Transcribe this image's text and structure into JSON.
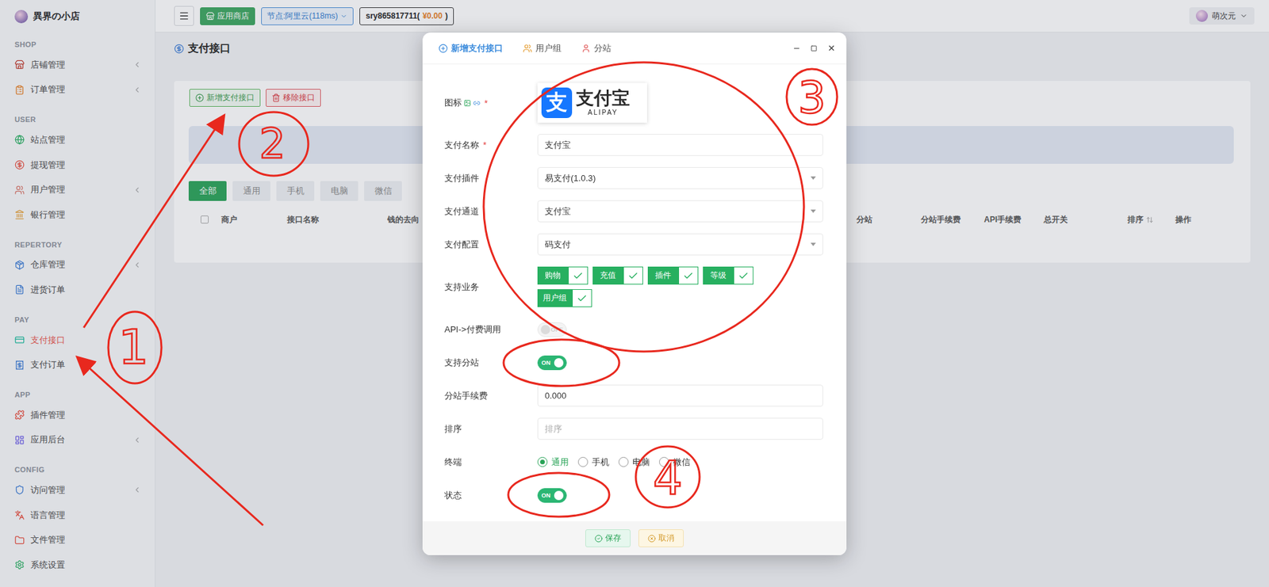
{
  "sidebar": {
    "brand": "異界の小店",
    "sections": [
      {
        "title": "SHOP",
        "items": [
          {
            "label": "店铺管理",
            "expandable": true,
            "selected": false,
            "color": "#c0392b"
          },
          {
            "label": "订单管理",
            "expandable": true,
            "selected": false,
            "color": "#e67e22"
          }
        ]
      },
      {
        "title": "USER",
        "items": [
          {
            "label": "站点管理",
            "expandable": false,
            "selected": false,
            "color": "#27ae60"
          },
          {
            "label": "提现管理",
            "expandable": false,
            "selected": false,
            "color": "#e74c3c"
          },
          {
            "label": "用户管理",
            "expandable": true,
            "selected": false,
            "color": "#d9776a"
          },
          {
            "label": "银行管理",
            "expandable": false,
            "selected": false,
            "color": "#e6a23c"
          }
        ]
      },
      {
        "title": "REPERTORY",
        "items": [
          {
            "label": "仓库管理",
            "expandable": true,
            "selected": false,
            "color": "#3a7bd5"
          },
          {
            "label": "进货订单",
            "expandable": false,
            "selected": false,
            "color": "#3a7bd5"
          }
        ]
      },
      {
        "title": "PAY",
        "items": [
          {
            "label": "支付接口",
            "expandable": false,
            "selected": true,
            "color": "#1abc9c"
          },
          {
            "label": "支付订单",
            "expandable": false,
            "selected": false,
            "color": "#3a7bd5"
          }
        ]
      },
      {
        "title": "APP",
        "items": [
          {
            "label": "插件管理",
            "expandable": false,
            "selected": false,
            "color": "#e74c3c"
          },
          {
            "label": "应用后台",
            "expandable": true,
            "selected": false,
            "color": "#6c5ce7"
          }
        ]
      },
      {
        "title": "CONFIG",
        "items": [
          {
            "label": "访问管理",
            "expandable": true,
            "selected": false,
            "color": "#3a7bd5"
          },
          {
            "label": "语言管理",
            "expandable": false,
            "selected": false,
            "color": "#e74c3c"
          },
          {
            "label": "文件管理",
            "expandable": false,
            "selected": false,
            "color": "#e74c3c"
          },
          {
            "label": "系统设置",
            "expandable": false,
            "selected": false,
            "color": "#27ae60"
          }
        ]
      }
    ]
  },
  "topbar": {
    "app_store": "应用商店",
    "node": "节点:阿里云(118ms)",
    "account": "sry865817711(",
    "balance": "¥0.00",
    "account_end": ")",
    "user": "萌次元"
  },
  "page": {
    "title": "支付接口",
    "actions": [
      {
        "label": "新增支付接口",
        "kind": "add"
      },
      {
        "label": "移除接口",
        "kind": "remove"
      }
    ],
    "filters": [
      {
        "label": "全部",
        "selected": true
      },
      {
        "label": "通用",
        "selected": false
      },
      {
        "label": "手机",
        "selected": false
      },
      {
        "label": "电脑",
        "selected": false
      },
      {
        "label": "微信",
        "selected": false
      }
    ],
    "table": {
      "select_all": {
        "checked": false
      },
      "columns": [
        "商户",
        "接口名称",
        "钱的去向",
        "分站",
        "分站手续费",
        "API手续费",
        "总开关",
        "排序",
        "操作"
      ],
      "sortable_column": "排序"
    }
  },
  "modal": {
    "tabs": [
      {
        "label": "新增支付接口",
        "selected": true
      },
      {
        "label": "用户组",
        "selected": false
      },
      {
        "label": "分站",
        "selected": false
      }
    ],
    "fields": [
      {
        "kind": "image",
        "label": "图标",
        "required": true,
        "logo": {
          "mark": "支",
          "name": "支付宝",
          "sub": "ALIPAY"
        }
      },
      {
        "kind": "text",
        "label": "支付名称",
        "required": true,
        "value": "支付宝",
        "placeholder": ""
      },
      {
        "kind": "select",
        "label": "支付插件",
        "required": false,
        "value": "易支付(1.0.3)"
      },
      {
        "kind": "select",
        "label": "支付通道",
        "required": false,
        "value": "支付宝"
      },
      {
        "kind": "select",
        "label": "支付配置",
        "required": false,
        "value": "码支付"
      },
      {
        "kind": "checks",
        "label": "支持业务",
        "required": false,
        "options": [
          {
            "label": "购物",
            "checked": true
          },
          {
            "label": "充值",
            "checked": true
          },
          {
            "label": "插件",
            "checked": true
          },
          {
            "label": "等级",
            "checked": true
          },
          {
            "label": "用户组",
            "checked": true
          }
        ]
      },
      {
        "kind": "switch",
        "label": "API->付费调用",
        "required": false,
        "on": false,
        "disabled": true,
        "text": "OFF"
      },
      {
        "kind": "switch",
        "label": "支持分站",
        "required": false,
        "on": true,
        "disabled": false,
        "text": "ON"
      },
      {
        "kind": "text",
        "label": "分站手续费",
        "required": false,
        "value": "0.000",
        "placeholder": ""
      },
      {
        "kind": "text",
        "label": "排序",
        "required": false,
        "value": "",
        "placeholder": "排序"
      },
      {
        "kind": "radios",
        "label": "终端",
        "required": false,
        "options": [
          {
            "label": "通用",
            "selected": true
          },
          {
            "label": "手机",
            "selected": false
          },
          {
            "label": "电脑",
            "selected": false
          },
          {
            "label": "微信",
            "selected": false
          }
        ]
      },
      {
        "kind": "switch",
        "label": "状态",
        "required": false,
        "on": true,
        "disabled": false,
        "text": "ON"
      }
    ],
    "required_mark": "*",
    "buttons": [
      {
        "label": "保存",
        "kind": "primary"
      },
      {
        "label": "取消",
        "kind": "cancel"
      }
    ]
  },
  "annotations": [
    {
      "label": "1"
    },
    {
      "label": "2"
    },
    {
      "label": "3"
    },
    {
      "label": "4"
    }
  ]
}
